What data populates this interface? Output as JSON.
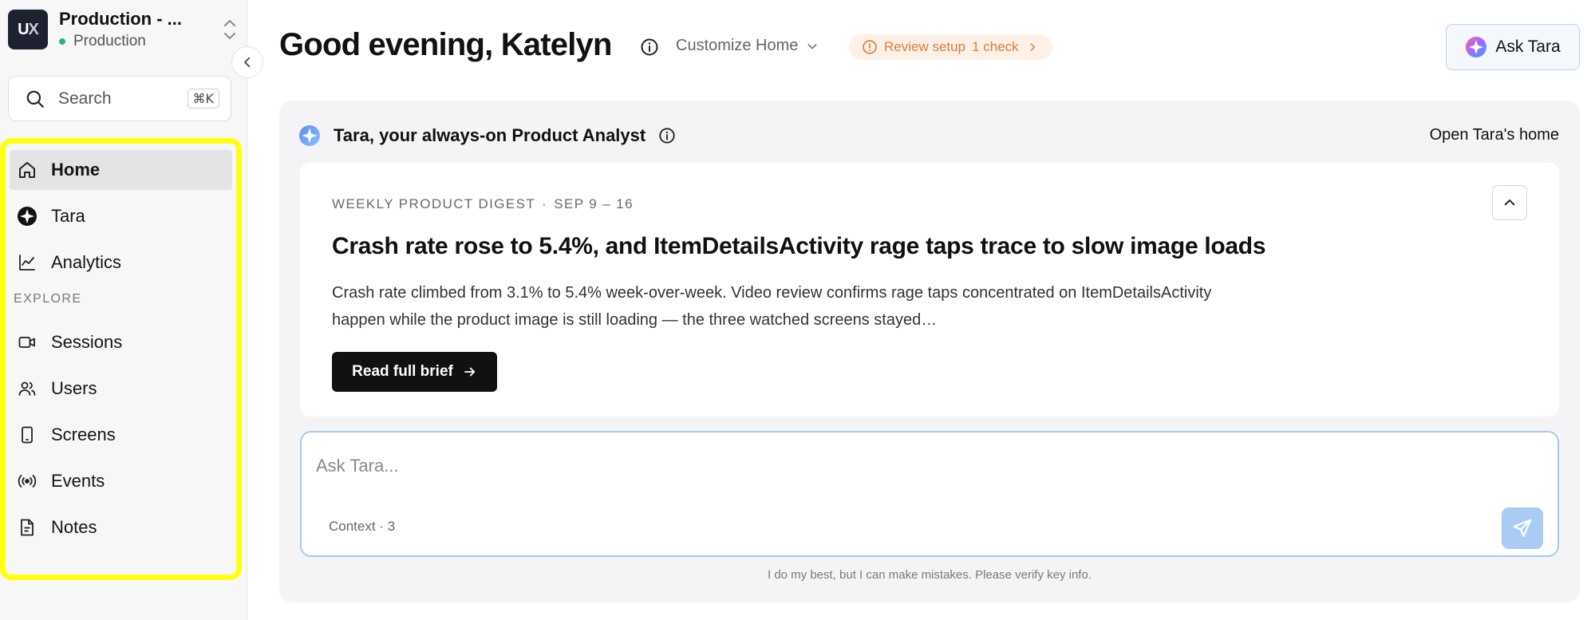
{
  "workspace": {
    "name": "Production - ...",
    "environment": "Production",
    "logo_u": "U",
    "logo_x": "X",
    "env_color": "#2bb673"
  },
  "search": {
    "label": "Search",
    "shortcut": "⌘K"
  },
  "nav": {
    "items_primary": [
      {
        "label": "Home",
        "icon": "home-icon",
        "active": true
      },
      {
        "label": "Tara",
        "icon": "tara-icon"
      },
      {
        "label": "Analytics",
        "icon": "analytics-icon"
      }
    ],
    "section_label": "EXPLORE",
    "items_explore": [
      {
        "label": "Sessions",
        "icon": "video-icon"
      },
      {
        "label": "Users",
        "icon": "users-icon"
      },
      {
        "label": "Screens",
        "icon": "phone-icon"
      },
      {
        "label": "Events",
        "icon": "broadcast-icon"
      },
      {
        "label": "Notes",
        "icon": "note-icon"
      }
    ],
    "highlight_color": "#ffff12"
  },
  "header": {
    "greeting": "Good evening, Katelyn",
    "customize": "Customize Home",
    "review_label": "Review setup",
    "review_count": "1 check",
    "ask_button": "Ask Tara"
  },
  "panel": {
    "title": "Tara, your always-on Product Analyst",
    "open_link": "Open Tara's home",
    "digest": {
      "category": "WEEKLY PRODUCT DIGEST",
      "separator": "·",
      "date_range": "SEP 9 – 16",
      "title": "Crash rate rose to 5.4%, and ItemDetailsActivity rage taps trace to slow image loads",
      "body": "Crash rate climbed from 3.1% to 5.4% week-over-week. Video review confirms rage taps concentrated on ItemDetailsActivity happen while the product image is still loading — the three watched screens stayed…",
      "button": "Read full brief"
    },
    "composer": {
      "placeholder": "Ask Tara...",
      "context_label": "Context · 3"
    },
    "disclaimer": "I do my best, but I can make mistakes. Please verify key info."
  },
  "colors": {
    "accent_blue": "#a9cbf4",
    "warning": "#e07d3b",
    "warning_bg": "#fdf1e7"
  }
}
